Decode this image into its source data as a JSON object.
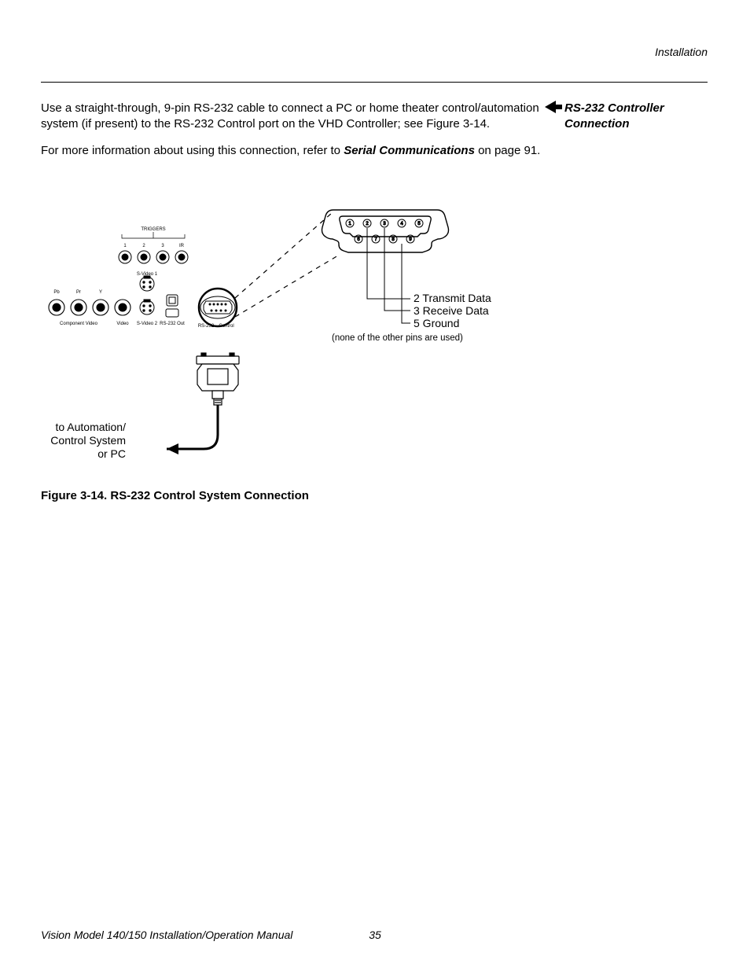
{
  "header": {
    "running": "Installation"
  },
  "side": {
    "heading_line1": "RS-232 Controller",
    "heading_line2": "Connection"
  },
  "body": {
    "p1_a": "Use a straight-through, 9-pin RS-232 cable to connect a PC or home theater control/automation system (if present) to the RS-232 Control port on the VHD Controller; see Figure 3-14.",
    "p2_a": "For more information about using this connection, refer to ",
    "p2_b": "Serial Communications",
    "p2_c": " on page 91."
  },
  "figure": {
    "caption": "Figure 3-14. RS-232 Control System Connection",
    "pin2": "2 Transmit Data",
    "pin3": "3 Receive Data",
    "pin5": "5 Ground",
    "none": "(none of the other pins are used)",
    "to_auto_l1": "to Automation/",
    "to_auto_l2": "Control System",
    "to_auto_l3": "or PC",
    "triggers": "TRIGGERS",
    "t1": "1",
    "t2": "2",
    "t3": "3",
    "tir": "IR",
    "pb": "Pb",
    "pr": "Pr",
    "y": "Y",
    "component": "Component Video",
    "video": "Video",
    "svideo1": "S-Video 1",
    "svideo2": "S-Video 2",
    "rs232out": "RS-232 Out",
    "rs232": "RS-232",
    "control": "Control",
    "db9_1": "1",
    "db9_2": "2",
    "db9_3": "3",
    "db9_4": "4",
    "db9_5": "5",
    "db9_6": "6",
    "db9_7": "7",
    "db9_8": "8",
    "db9_9": "9"
  },
  "footer": {
    "manual": "Vision Model 140/150 Installation/Operation Manual",
    "page": "35"
  }
}
